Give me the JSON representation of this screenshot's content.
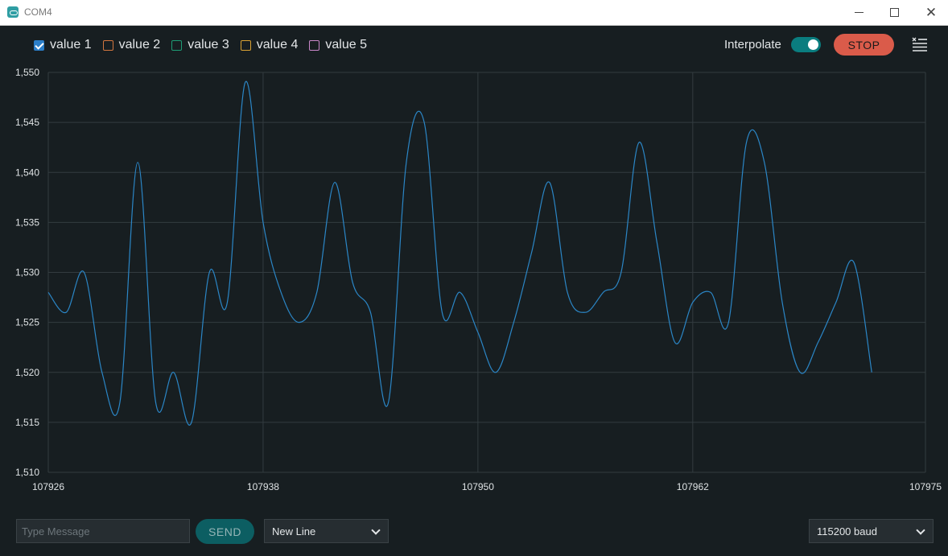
{
  "window": {
    "title": "COM4"
  },
  "legend": {
    "items": [
      {
        "label": "value 1",
        "checked": true,
        "color": "#2b7ec8"
      },
      {
        "label": "value 2",
        "checked": false,
        "color": "#d2763f"
      },
      {
        "label": "value 3",
        "checked": false,
        "color": "#1e9c75"
      },
      {
        "label": "value 4",
        "checked": false,
        "color": "#d9a234"
      },
      {
        "label": "value 5",
        "checked": false,
        "color": "#c987c9"
      }
    ]
  },
  "toolbar": {
    "interpolate_label": "Interpolate",
    "interpolate_on": true,
    "stop_label": "STOP",
    "clear_icon": "clear-output-icon"
  },
  "footer": {
    "message_placeholder": "Type Message",
    "send_label": "SEND",
    "line_ending": "New Line",
    "baud_rate": "115200 baud"
  },
  "colors": {
    "background": "#171e21",
    "grid": "#333c40",
    "series": "#2b86c6",
    "stop": "#da5b4a",
    "accent": "#0a7d7f"
  },
  "chart_data": {
    "type": "line",
    "x_ticks": [
      "107926",
      "107938",
      "107950",
      "107962",
      "107975"
    ],
    "y_ticks": [
      "1,510",
      "1,515",
      "1,520",
      "1,525",
      "1,530",
      "1,535",
      "1,540",
      "1,545",
      "1,550"
    ],
    "xlim": [
      107926,
      107975
    ],
    "ylim": [
      1510,
      1550
    ],
    "grid": true,
    "series": [
      {
        "name": "value 1",
        "color": "#2b86c6",
        "x": [
          107926,
          107927,
          107928,
          107929,
          107930,
          107931,
          107932,
          107933,
          107934,
          107935,
          107936,
          107937,
          107938,
          107939,
          107940,
          107941,
          107942,
          107943,
          107944,
          107945,
          107946,
          107947,
          107948,
          107949,
          107950,
          107951,
          107952,
          107953,
          107954,
          107955,
          107956,
          107957,
          107958,
          107959,
          107960,
          107961,
          107962,
          107963,
          107964,
          107965,
          107966,
          107967,
          107968,
          107969,
          107970,
          107971,
          107972
        ],
        "values": [
          1528,
          1526,
          1530,
          1520,
          1517,
          1541,
          1517,
          1520,
          1515,
          1530,
          1527,
          1549,
          1535,
          1528,
          1525,
          1528,
          1539,
          1529,
          1526,
          1517,
          1541,
          1545,
          1526,
          1528,
          1524,
          1520,
          1525,
          1532,
          1539,
          1528,
          1526,
          1528,
          1530,
          1543,
          1533,
          1523,
          1527,
          1528,
          1525,
          1543,
          1541,
          1527,
          1520,
          1523,
          1527,
          1531,
          1520
        ]
      }
    ]
  }
}
